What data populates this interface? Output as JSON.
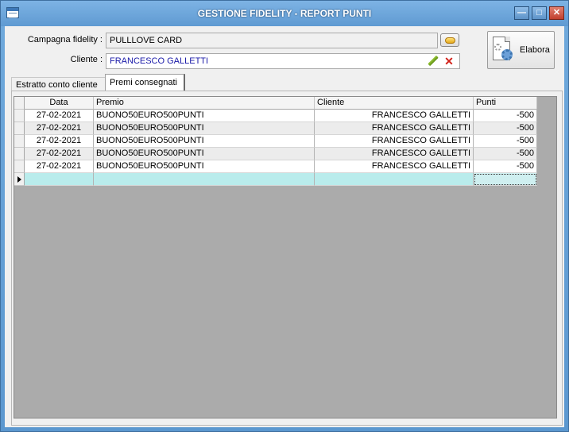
{
  "window": {
    "title": "GESTIONE FIDELITY - REPORT PUNTI",
    "minimize_label": "—",
    "maximize_label": "□",
    "close_label": "✕"
  },
  "form": {
    "campagna_label": "Campagna fidelity :",
    "campagna_value": "PULLLOVE CARD",
    "cliente_label": "Cliente :",
    "cliente_value": "FRANCESCO GALLETTI"
  },
  "elabora": {
    "label": "Elabora"
  },
  "tabs": [
    {
      "label": "Estratto conto cliente",
      "active": false
    },
    {
      "label": "Premi consegnati",
      "active": true
    }
  ],
  "grid": {
    "columns": [
      "Data",
      "Premio",
      "Cliente",
      "Punti"
    ],
    "rows": [
      [
        "27-02-2021",
        "BUONO50EURO500PUNTI",
        "FRANCESCO GALLETTI",
        "-500"
      ],
      [
        "27-02-2021",
        "BUONO50EURO500PUNTI",
        "FRANCESCO GALLETTI",
        "-500"
      ],
      [
        "27-02-2021",
        "BUONO50EURO500PUNTI",
        "FRANCESCO GALLETTI",
        "-500"
      ],
      [
        "27-02-2021",
        "BUONO50EURO500PUNTI",
        "FRANCESCO GALLETTI",
        "-500"
      ],
      [
        "27-02-2021",
        "BUONO50EURO500PUNTI",
        "FRANCESCO GALLETTI",
        "-500"
      ]
    ]
  },
  "colors": {
    "titlebar": "#6fa9dc",
    "new_row": "#b9ecec",
    "grid_background": "#ababab"
  },
  "icons": {
    "app": "app-window-icon",
    "folder": "folder-open-icon",
    "edit": "pencil-icon",
    "clear": "x-icon",
    "elabora": "document-gear-icon"
  }
}
